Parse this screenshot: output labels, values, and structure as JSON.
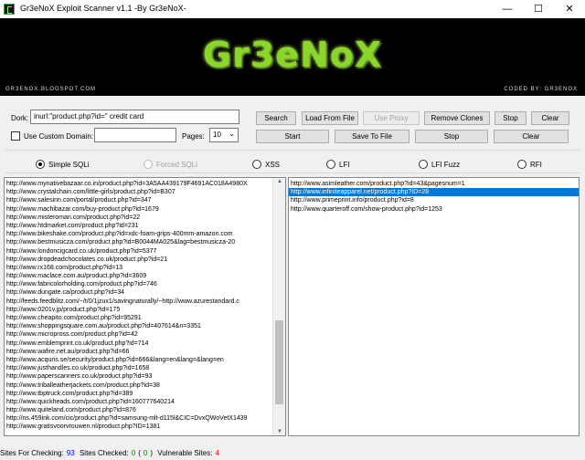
{
  "window": {
    "title": "Gr3eNoX Exploit Scanner v1.1 -By Gr3eNoX-",
    "minimize": "—",
    "maximize": "☐",
    "close": "✕"
  },
  "banner": {
    "logo": "Gr3eNoX",
    "blog": "GR3ENOX.BLOGSPOT.COM",
    "coded_by": "CODED BY: GR3ENOX"
  },
  "form": {
    "dork_label": "Dork:",
    "dork_value": "inurl:\"product.php?id=\" credit card",
    "custom_domain_label": "Use Custom Domain:",
    "custom_domain_value": "",
    "pages_label": "Pages:",
    "pages_value": "10",
    "pages_arrow": "⌄"
  },
  "buttons": {
    "search": "Search",
    "load_from_file": "Load From File",
    "use_proxy": "Use Proxy",
    "remove_clones": "Remove Clones",
    "stop_top": "Stop",
    "clear_top": "Clear",
    "start": "Start",
    "save_to_file": "Save To File",
    "stop": "Stop",
    "clear": "Clear"
  },
  "modes": [
    {
      "label": "Simple SQLi",
      "checked": true,
      "disabled": false
    },
    {
      "label": "Forced SQLi",
      "checked": false,
      "disabled": true
    },
    {
      "label": "XSS",
      "checked": false,
      "disabled": false
    },
    {
      "label": "LFI",
      "checked": false,
      "disabled": false
    },
    {
      "label": "LFI Fuzz",
      "checked": false,
      "disabled": false
    },
    {
      "label": "RFI",
      "checked": false,
      "disabled": false
    }
  ],
  "sites_list": [
    "http://www.mynativebazaar.co.in/product.php?id=3A5AA439179F4691AC018A4980X",
    "http://www.crystalchain.com/little-girls/product.php?id=B307",
    "http://www.salesinn.com/portal/product.php?id=347",
    "http://www.machibazar.com/buy-product.php?id=1679",
    "http://www.misteroman.com/product.php?id=22",
    "http://www.htdmarket.com/product.php?id=231",
    "http://www.bikeshake.com/product.php?id=xdc-foam-grips-400mm-amazon.com",
    "http://www.bestmusicza.com/product.php?id=B0044MA025&lag=bestmusicza-20",
    "http://www.londoncigcard.co.uk/product.php?id=5377",
    "http://www.dropdeadchocolates.co.uk/product.php?id=21",
    "http://www.rx168.com/product.php?id=13",
    "http://www.maclace.com.au/product.php?id=3609",
    "http://www.fabricolorholding.com/product.php?id=746",
    "http://www.dungate.ca/product.php?id=34",
    "http://feeds.feedblitz.com/~/t/0/1jzux1/savingnaturally/~http://www.azurestandard.c",
    "http://www.0201v.jp/product.php?id=175",
    "http://www.cheapito.com/product.php?id=95291",
    "http://www.shoppingsquare.com.au/product.php?id=407614&n=3351",
    "http://www.micropross.com/product.php?id=42",
    "http://www.emblemprint.co.uk/product.php?id=714",
    "http://www.wafire.net.au/product.php?id=66",
    "http://www.acquris.se/security/product.php?id=666&lang=en&lang=&lang=en",
    "http://www.justhandles.co.uk/product.php?id=1658",
    "http://www.paperscanners.co.uk/product.php?id=93",
    "http://www.triballeatherjackets.com/product.php?id=38",
    "http://www.tbptruck.com/product.php?id=389",
    "http://www.quickheads.com/product.php?id=160777640214",
    "http://www.quiteland.com/product.php?id=876",
    "http://ns.459ink.com/cic/product.php?id=samsung-mlt-d115l&CIC=DvxQWoVetX1439",
    "http://www.gratisvoorvrouwen.nl/product.php?ID=1381"
  ],
  "vulnerable_list": [
    {
      "url": "http://www.asimleather.com/product.php?id=43&pagesnum=1",
      "selected": false
    },
    {
      "url": "http://www.infiniteapparel.net/product.php?ID=28",
      "selected": true
    },
    {
      "url": "http://www.primeprint.info/product.php?id=8",
      "selected": false
    },
    {
      "url": "http://www.quarteroff.com/show-product.php?id=1253",
      "selected": false
    }
  ],
  "status": {
    "checking_label": "Sites For Checking:",
    "checking_value": "93",
    "checked_label": "Sites Checked:",
    "checked_value": "0",
    "checked_open": "(",
    "checked_paren": "0",
    "checked_close": ")",
    "vulnerable_label": "Vulnerable Sites:",
    "vulnerable_value": "4"
  },
  "colors": {
    "logo_green": "#8ad62a",
    "selection_blue": "#0078d7",
    "count_blue": "#0000ff",
    "count_green": "#008000",
    "count_red": "#ff0000"
  }
}
